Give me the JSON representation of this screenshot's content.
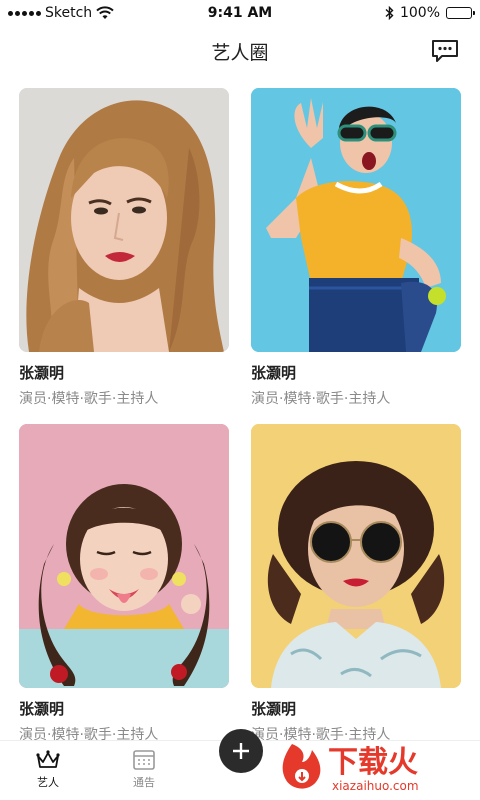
{
  "status_bar": {
    "carrier": "Sketch",
    "time": "9:41 AM",
    "battery": "100%",
    "battery_level": 1.0
  },
  "nav": {
    "title": "艺人圈",
    "message_icon": "chat-bubble-icon"
  },
  "artists": [
    {
      "name": "张灏明",
      "roles": "演员·模特·歌手·主持人"
    },
    {
      "name": "张灏明",
      "roles": "演员·模特·歌手·主持人"
    },
    {
      "name": "张灏明",
      "roles": "演员·模特·歌手·主持人"
    },
    {
      "name": "张灏明",
      "roles": "演员·模特·歌手·主持人"
    }
  ],
  "tabs": [
    {
      "label": "艺人",
      "icon": "crown-icon",
      "active": true
    },
    {
      "label": "通告",
      "icon": "calendar-icon",
      "active": false
    }
  ],
  "add_icon": "plus-icon",
  "watermark": {
    "text": "下载火",
    "url_text": "xiazaihuo.com"
  },
  "colors": {
    "accent_dark": "#2b2b2b",
    "muted_text": "#8a8a8a",
    "watermark_red": "#e4392b"
  }
}
